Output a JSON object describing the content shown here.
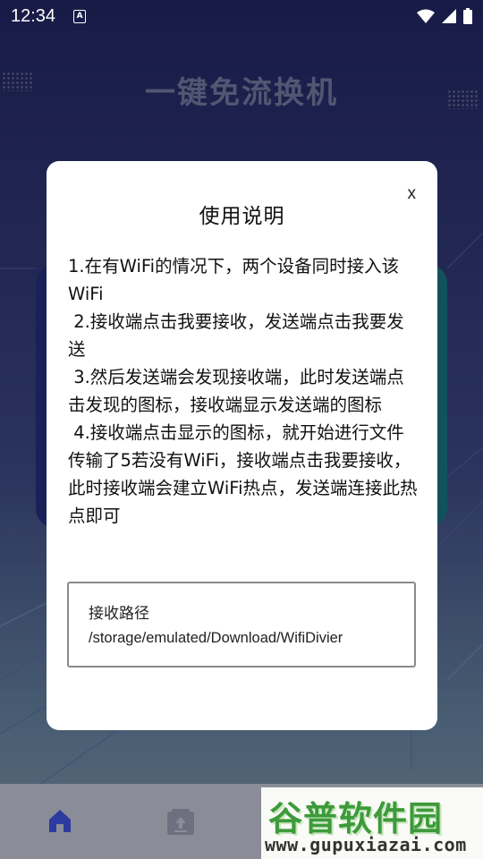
{
  "status_bar": {
    "time": "12:34",
    "notification_icon": "A",
    "icons": [
      "wifi-icon",
      "signal-icon",
      "battery-icon"
    ]
  },
  "app": {
    "title": "一键免流换机"
  },
  "dialog": {
    "title": "使用说明",
    "close_label": "x",
    "instructions": "1.在有WiFi的情况下，两个设备同时接入该WiFi\n 2.接收端点击我要接收，发送端点击我要发送\n 3.然后发送端会发现接收端，此时发送端点击发现的图标，接收端显示发送端的图标\n 4.接收端点击显示的图标，就开始进行文件传输了5若没有WiFi，接收端点击我要接收，此时接收端会建立WiFi热点，发送端连接此热点即可",
    "path_label": "接收路径",
    "path_value": "/storage/emulated/Download/WifiDivier"
  },
  "bottom_nav": {
    "items": [
      "home-icon",
      "upload-box-icon"
    ]
  },
  "watermark": {
    "top_text": "谷普软件园",
    "bottom_text": "www.gupuxiazai.com"
  },
  "colors": {
    "accent": "#2a3aa0",
    "nav_icon": "#2d3aa0",
    "watermark_green": "#3e9a3a"
  }
}
